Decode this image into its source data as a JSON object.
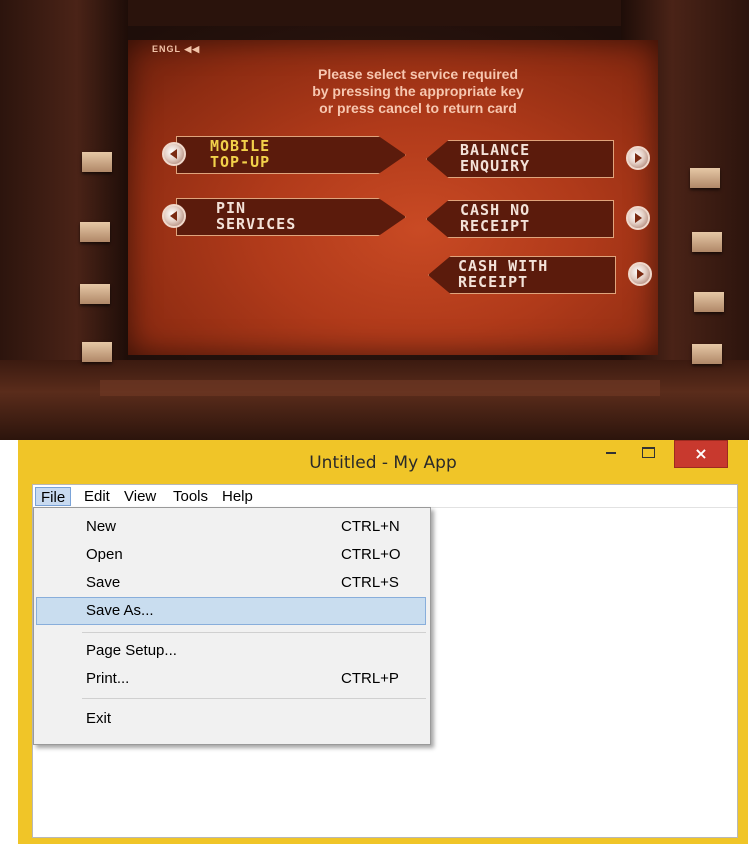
{
  "atm": {
    "corner_text": "ENGL ◀◀",
    "prompt": "Please select service required\nby pressing the appropriate key\nor press cancel to return card",
    "options_left": [
      {
        "label": "MOBILE\nTOP-UP"
      },
      {
        "label": "PIN\nSERVICES"
      }
    ],
    "options_right": [
      {
        "label": "BALANCE\nENQUIRY"
      },
      {
        "label": "CASH NO\nRECEIPT"
      },
      {
        "label": "CASH WITH\nRECEIPT"
      }
    ]
  },
  "window": {
    "title": "Untitled - My App",
    "close_glyph": "×",
    "accent_color": "#f0c528",
    "close_color": "#c8392e"
  },
  "menubar": {
    "items": [
      "File",
      "Edit",
      "View",
      "Tools",
      "Help"
    ]
  },
  "file_menu": {
    "items": [
      {
        "label": "New",
        "shortcut": "CTRL+N"
      },
      {
        "label": "Open",
        "shortcut": "CTRL+O"
      },
      {
        "label": "Save",
        "shortcut": "CTRL+S"
      },
      {
        "label": "Save As...",
        "shortcut": ""
      },
      {
        "label": "Page Setup...",
        "shortcut": ""
      },
      {
        "label": "Print...",
        "shortcut": "CTRL+P"
      },
      {
        "label": "Exit",
        "shortcut": ""
      }
    ],
    "highlighted": "Save As..."
  }
}
